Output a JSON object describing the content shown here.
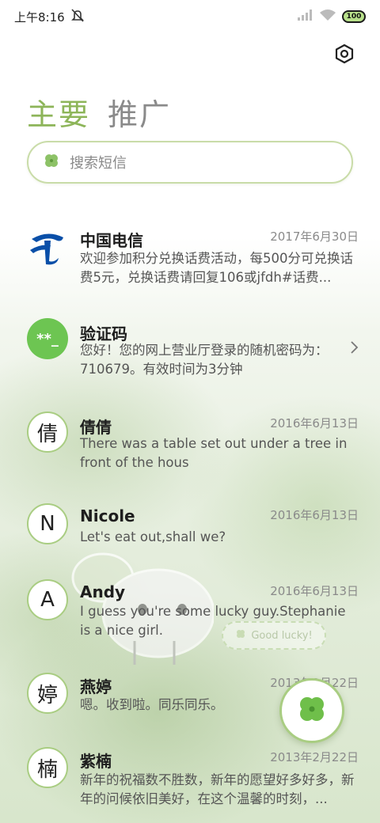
{
  "status_bar": {
    "time": "上午8:16",
    "battery": "100"
  },
  "tabs": [
    {
      "label": "主要",
      "active": true
    },
    {
      "label": "推广",
      "active": false
    }
  ],
  "search": {
    "placeholder": "搜索短信",
    "icon": "clover-icon"
  },
  "decor": {
    "lucky_text": "Good lucky!"
  },
  "threads": [
    {
      "avatar": "china-telecom-logo",
      "avatar_text": "",
      "name": "中国电信",
      "time": "2017年6月30日",
      "preview": "欢迎参加积分兑换话费活动，每500分可兑换话费5元，兑换话费请回复106或jfdh#话费..."
    },
    {
      "avatar": "verification-code",
      "avatar_text": "**_",
      "name": "验证码",
      "time": "",
      "preview": "您好！您的网上营业厅登录的随机密码为：710679。有效时间为3分钟"
    },
    {
      "avatar": "letter",
      "avatar_text": "倩",
      "name": "倩倩",
      "time": "2016年6月13日",
      "preview": "There was a table set out under a tree in front of the hous"
    },
    {
      "avatar": "letter",
      "avatar_text": "N",
      "name": "Nicole",
      "time": "2016年6月13日",
      "preview": "Let's eat out,shall we?"
    },
    {
      "avatar": "letter",
      "avatar_text": "A",
      "name": "Andy",
      "time": "2016年6月13日",
      "preview": "I guess you're some lucky guy.Stephanie is a nice girl."
    },
    {
      "avatar": "letter",
      "avatar_text": "婷",
      "name": "燕婷",
      "time": "2013年2月22日",
      "preview": "嗯。收到啦。同乐同乐。"
    },
    {
      "avatar": "letter",
      "avatar_text": "楠",
      "name": "紫楠",
      "time": "2013年2月22日",
      "preview": "新年的祝福数不胜数，新年的愿望好多好多，新年的问候依旧美好，在这个温馨的时刻，..."
    }
  ],
  "colors": {
    "accent": "#8db559",
    "avatar_border": "#a9cd82",
    "code_avatar": "#6dc552"
  }
}
